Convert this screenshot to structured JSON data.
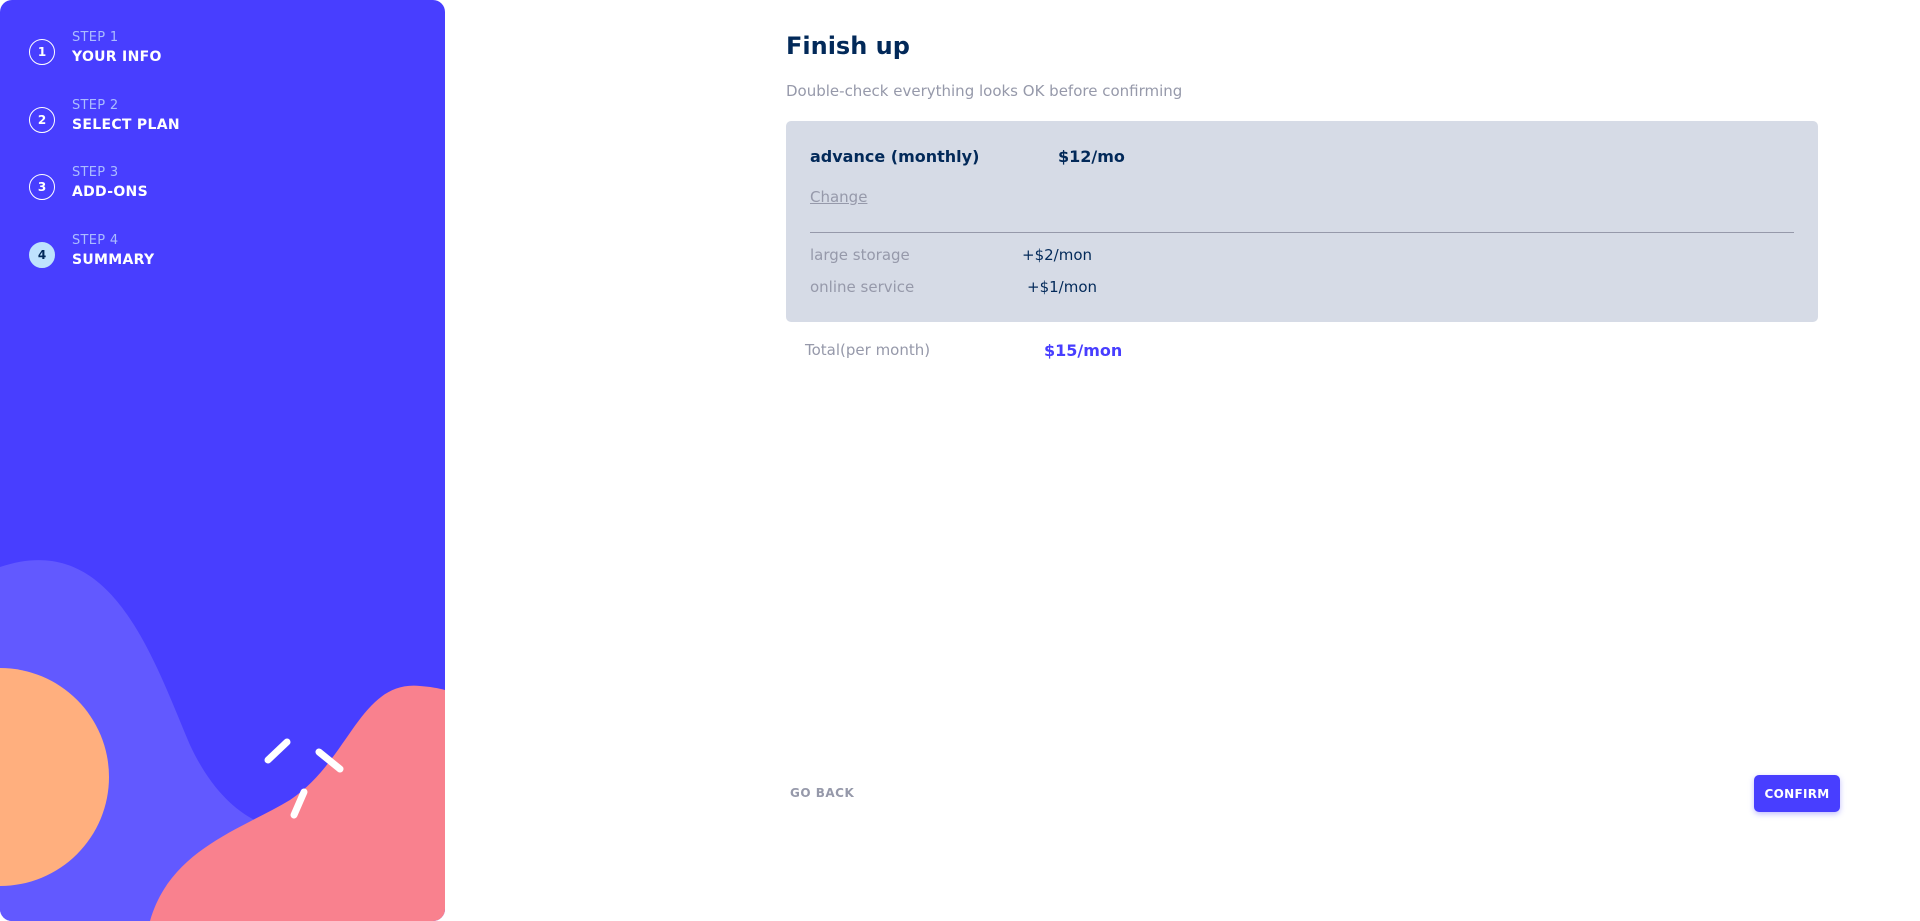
{
  "colors": {
    "sidebar_bg": "#483eff",
    "accent": "#483eff",
    "marine_blue": "#022959",
    "grey_text": "#9699aa",
    "summary_bg": "#d6dbe6",
    "active_step_bg": "#bee2fd",
    "deco_light_purple": "#6259ff",
    "deco_orange": "#ffaf7e",
    "deco_pink": "#f9818e"
  },
  "sidebar": {
    "steps": [
      {
        "number": "1",
        "label": "STEP 1",
        "title": "YOUR INFO",
        "active": false
      },
      {
        "number": "2",
        "label": "STEP 2",
        "title": "SELECT PLAN",
        "active": false
      },
      {
        "number": "3",
        "label": "STEP 3",
        "title": "ADD-ONS",
        "active": false
      },
      {
        "number": "4",
        "label": "STEP 4",
        "title": "SUMMARY",
        "active": true
      }
    ]
  },
  "main": {
    "title": "Finish up",
    "subtitle": "Double-check everything looks OK before confirming",
    "summary": {
      "plan_name": "advance (monthly)",
      "plan_price": "$12/mo",
      "change_label": "Change",
      "addons": [
        {
          "name": "large storage",
          "price": "+$2/mon"
        },
        {
          "name": "online service",
          "price": "+$1/mon"
        }
      ]
    },
    "total": {
      "label": "Total(per month)",
      "price": "$15/mon"
    }
  },
  "footer": {
    "back_label": "GO BACK",
    "confirm_label": "CONFIRM"
  }
}
